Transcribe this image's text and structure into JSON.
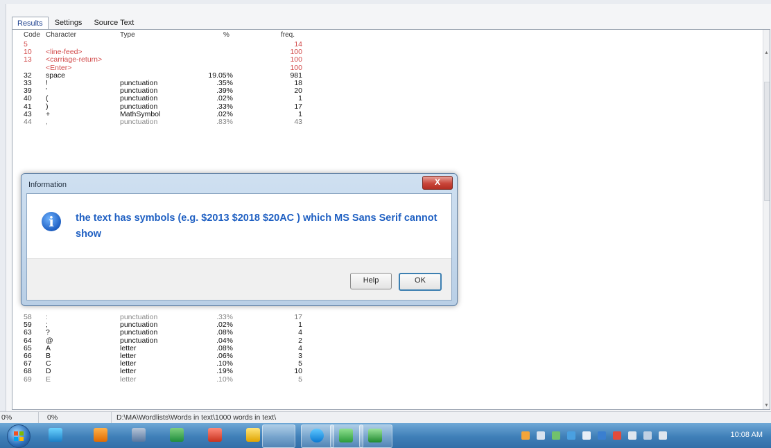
{
  "tabs": [
    {
      "label": "Results"
    },
    {
      "label": "Settings"
    },
    {
      "label": "Source Text"
    }
  ],
  "columns": {
    "code": "Code",
    "character": "Character",
    "type": "Type",
    "pct": "%",
    "freq": "freq."
  },
  "rows_top": [
    {
      "code": "5",
      "character": "",
      "type": "",
      "pct": "",
      "freq": "14",
      "style": "red"
    },
    {
      "code": "10",
      "character": "<line-feed>",
      "type": "",
      "pct": "",
      "freq": "100",
      "style": "red"
    },
    {
      "code": "13",
      "character": "<carriage-return>",
      "type": "",
      "pct": "",
      "freq": "100",
      "style": "red"
    },
    {
      "code": "",
      "character": "<Enter>",
      "type": "",
      "pct": "",
      "freq": "100",
      "style": "red"
    },
    {
      "code": "32",
      "character": "space",
      "type": "",
      "pct": "19.05%",
      "freq": "981",
      "style": ""
    },
    {
      "code": "33",
      "character": "!",
      "type": "punctuation",
      "pct": ".35%",
      "freq": "18",
      "style": ""
    },
    {
      "code": "39",
      "character": "'",
      "type": "punctuation",
      "pct": ".39%",
      "freq": "20",
      "style": ""
    },
    {
      "code": "40",
      "character": "(",
      "type": "punctuation",
      "pct": ".02%",
      "freq": "1",
      "style": ""
    },
    {
      "code": "41",
      "character": ")",
      "type": "punctuation",
      "pct": ".33%",
      "freq": "17",
      "style": ""
    },
    {
      "code": "43",
      "character": "+",
      "type": "MathSymbol",
      "pct": ".02%",
      "freq": "1",
      "style": ""
    },
    {
      "code": "44",
      "character": ",",
      "type": "punctuation",
      "pct": ".83%",
      "freq": "43",
      "style": "faded"
    }
  ],
  "rows_bottom": [
    {
      "code": "58",
      "character": ":",
      "type": "punctuation",
      "pct": ".33%",
      "freq": "17",
      "style": "faded"
    },
    {
      "code": "59",
      "character": ";",
      "type": "punctuation",
      "pct": ".02%",
      "freq": "1",
      "style": ""
    },
    {
      "code": "63",
      "character": "?",
      "type": "punctuation",
      "pct": ".08%",
      "freq": "4",
      "style": ""
    },
    {
      "code": "64",
      "character": "@",
      "type": "punctuation",
      "pct": ".04%",
      "freq": "2",
      "style": ""
    },
    {
      "code": "65",
      "character": "A",
      "type": "letter",
      "pct": ".08%",
      "freq": "4",
      "style": ""
    },
    {
      "code": "66",
      "character": "B",
      "type": "letter",
      "pct": ".06%",
      "freq": "3",
      "style": ""
    },
    {
      "code": "67",
      "character": "C",
      "type": "letter",
      "pct": ".10%",
      "freq": "5",
      "style": ""
    },
    {
      "code": "68",
      "character": "D",
      "type": "letter",
      "pct": ".19%",
      "freq": "10",
      "style": ""
    },
    {
      "code": "69",
      "character": "E",
      "type": "letter",
      "pct": ".10%",
      "freq": "5",
      "style": "faded"
    }
  ],
  "statusbar": {
    "left1": "0%",
    "left2": "0%",
    "path": "D:\\MA\\Wordlists\\Words in text\\1000 words in text\\"
  },
  "dialog": {
    "title": "Information",
    "close": "X",
    "message": "the text has symbols (e.g. $2013 $2018 $20AC ) which MS Sans Serif cannot show",
    "help_label": "Help",
    "ok_label": "OK"
  },
  "taskbar": {
    "clock": "10:08 AM"
  }
}
